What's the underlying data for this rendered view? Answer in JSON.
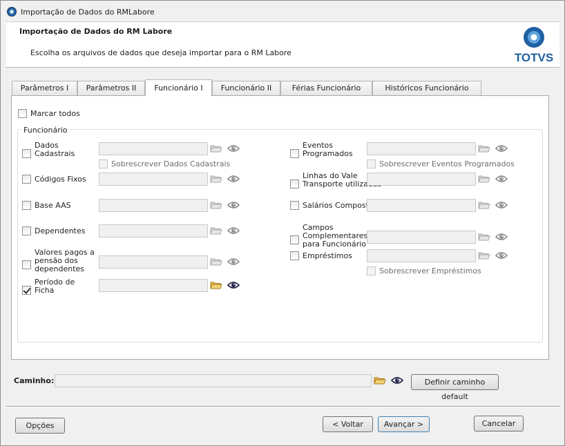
{
  "window": {
    "title": "Importação de Dados do RMLabore"
  },
  "header": {
    "title": "Importação de Dados do RM Labore",
    "subtitle": "Escolha os arquivos de dados que deseja importar para o RM Labore",
    "logo_text": "TOTVS"
  },
  "tabs": [
    {
      "label": "Parâmetros I",
      "active": false
    },
    {
      "label": "Parâmetros II",
      "active": false
    },
    {
      "label": "Funcionário I",
      "active": true
    },
    {
      "label": "Funcionário II",
      "active": false
    },
    {
      "label": "Férias Funcionário",
      "active": false
    },
    {
      "label": "Históricos Funcionário",
      "active": false
    }
  ],
  "panel": {
    "mark_all_label": "Marcar todos",
    "mark_all_checked": false,
    "group_title": "Funcionário",
    "left_items": [
      {
        "label": "Dados\nCadastrais",
        "checked": false,
        "enabled": false,
        "overwrite": "Sobrescrever Dados Cadastrais"
      },
      {
        "label": "Códigos Fixos",
        "checked": false,
        "enabled": false
      },
      {
        "label": "Base AAS",
        "checked": false,
        "enabled": false
      },
      {
        "label": "Dependentes",
        "checked": false,
        "enabled": false
      },
      {
        "label": "Valores pagos a\npensão dos\ndependentes",
        "checked": false,
        "enabled": false
      },
      {
        "label": "Período de\nFicha",
        "checked": true,
        "enabled": true
      }
    ],
    "right_items": [
      {
        "label": "Eventos\nProgramados",
        "checked": false,
        "enabled": false,
        "overwrite": "Sobrescrever Eventos Programados"
      },
      {
        "label": "Linhas do Vale\nTransporte utilizadas",
        "checked": false,
        "enabled": false
      },
      {
        "label": "Salários Compostos",
        "checked": false,
        "enabled": false
      },
      {
        "label": "Campos\nComplementares\npara Funcionário",
        "checked": false,
        "enabled": false
      },
      {
        "label": "Empréstimos",
        "checked": false,
        "enabled": false,
        "overwrite": "Sobrescrever Empréstimos"
      }
    ]
  },
  "path": {
    "label": "Caminho:",
    "value": "",
    "default_button": "Definir caminho default"
  },
  "footer": {
    "options": "Opções",
    "back": "< Voltar",
    "next": "Avançar >",
    "cancel": "Cancelar"
  },
  "colors": {
    "logo_blue": "#1f5fa3",
    "folder_yellow": "#e8b84a"
  }
}
